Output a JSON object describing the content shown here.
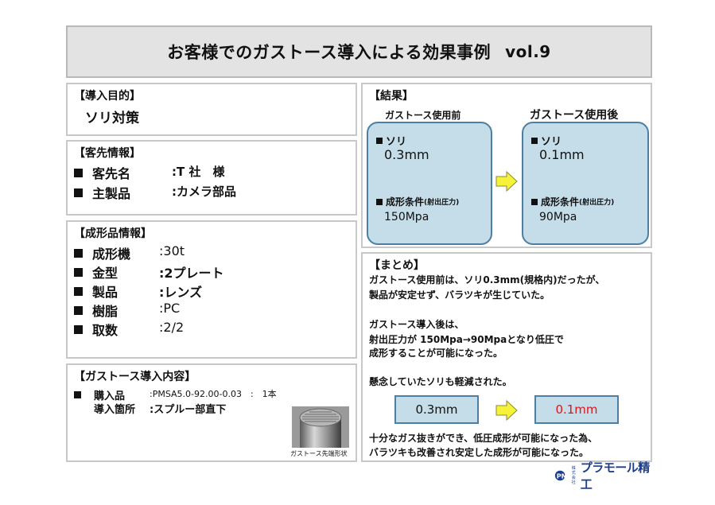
{
  "title": {
    "main": "お客様でのガストース導入による効果事例",
    "vol": "vol.9"
  },
  "purpose": {
    "heading": "【導入目的】",
    "text": "ソリ対策"
  },
  "customer": {
    "heading": "【客先情報】",
    "rows": [
      {
        "label": "客先名",
        "value": ":T 社　様"
      },
      {
        "label": "主製品",
        "value": ":カメラ部品"
      }
    ]
  },
  "product": {
    "heading": "【成形品情報】",
    "rows": [
      {
        "label": "成形機",
        "value": ":30t"
      },
      {
        "label": "金型",
        "value": ":2プレート"
      },
      {
        "label": "製品",
        "value": ":レンズ"
      },
      {
        "label": "樹脂",
        "value": ":PC"
      },
      {
        "label": "取数",
        "value": ":2/2"
      }
    ]
  },
  "gastos": {
    "heading": "【ガストース導入内容】",
    "purchase_label": "購入品",
    "purchase_value": ":PMSA5.0-92.00-0.03　:　1本",
    "location_label": "導入箇所",
    "location_value": ":スプルー部直下",
    "photo_caption": "ガストース先端形状"
  },
  "result": {
    "heading": "【結果】",
    "before": {
      "title": "ガストース使用前",
      "sori_label": "ソリ",
      "sori_value": "0.3mm",
      "cond_label": "成形条件",
      "cond_sub": "(射出圧力)",
      "cond_value": "150Mpa"
    },
    "after": {
      "title": "ガストース使用後",
      "sori_label": "ソリ",
      "sori_value": "0.1mm",
      "cond_label": "成形条件",
      "cond_sub": "(射出圧力)",
      "cond_value": "90Mpa"
    }
  },
  "summary": {
    "heading": "【まとめ】",
    "line1": "ガストース使用前は、ソリ0.3mm(規格内)だったが、",
    "line2": "製品が安定せず、バラツキが生じていた。",
    "line3": "ガストース導入後は、",
    "line4": "射出圧力が 150Mpa→90Mpaとなり低圧で",
    "line5": "成形することが可能になった。",
    "line6": "懸念していたソリも軽減された。",
    "box_before": "0.3mm",
    "box_after": "0.1mm",
    "line7": "十分なガス抜きができ、低圧成形が可能になった為、",
    "line8": "バラツキも改善され安定した成形が可能になった。"
  },
  "logo": {
    "mark": "PM",
    "small": "株式会社",
    "name": "プラモール精工"
  },
  "colors": {
    "bubble_fill": "#c4dde8",
    "bubble_border": "#4c7fa2",
    "arrow_fill": "#f6f23a",
    "highlight_red": "#e0141a"
  }
}
